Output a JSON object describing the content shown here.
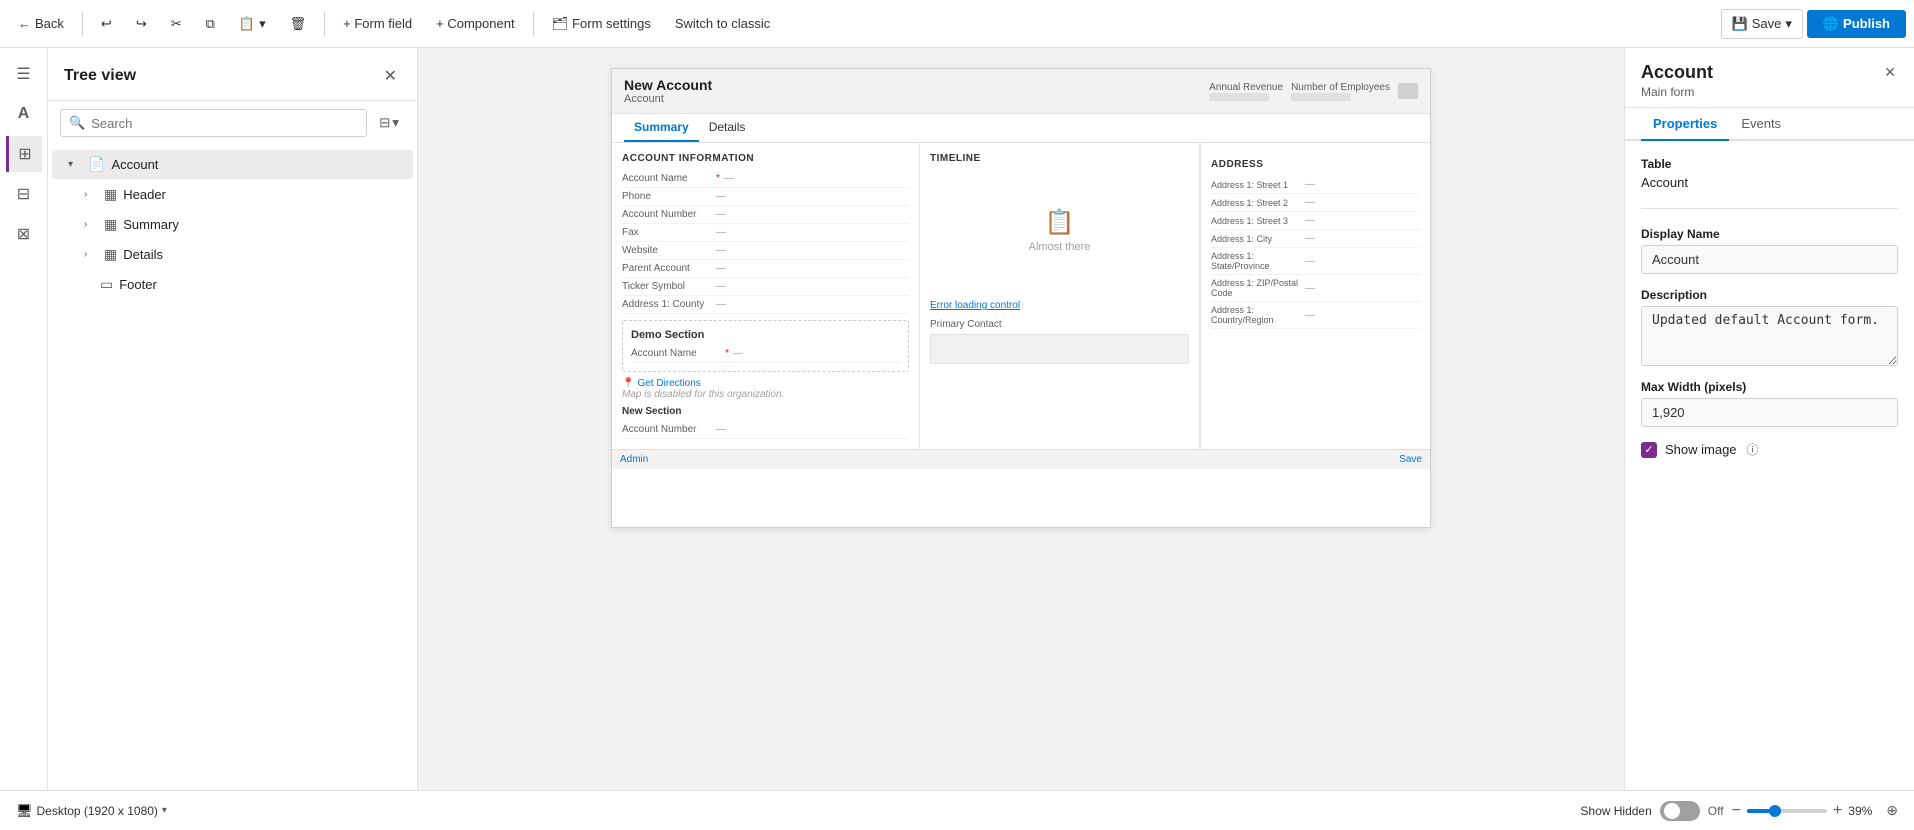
{
  "toolbar": {
    "back_label": "Back",
    "undo_icon": "↩",
    "redo_icon": "↪",
    "cut_icon": "✂",
    "copy_icon": "⧉",
    "paste_icon": "⬇",
    "undo_dropdown_icon": "▾",
    "delete_icon": "🗑",
    "form_field_label": "+ Form field",
    "component_label": "+ Component",
    "form_settings_label": "Form settings",
    "switch_classic_label": "Switch to classic",
    "save_label": "Save",
    "save_dropdown_icon": "▾",
    "publish_label": "Publish"
  },
  "sidebar": {
    "title": "Tree view",
    "close_icon": "✕",
    "search_placeholder": "Search",
    "filter_icon": "⊟",
    "filter_dropdown_icon": "▾",
    "tree": {
      "account": {
        "label": "Account",
        "chevron": "▾",
        "children": {
          "header": {
            "label": "Header",
            "chevron": "›"
          },
          "summary": {
            "label": "Summary",
            "chevron": "›"
          },
          "details": {
            "label": "Details",
            "chevron": "›"
          },
          "footer": {
            "label": "Footer"
          }
        }
      }
    }
  },
  "icon_bar": {
    "menu_icon": "☰",
    "text_icon": "A",
    "layers_icon": "⊞",
    "components_icon": "⊟",
    "grid_icon": "⊞"
  },
  "canvas": {
    "form_title": "New Account",
    "form_subtitle": "Account",
    "header_field1_label": "Annual Revenue",
    "header_field2_label": "Number of Employees",
    "tabs": {
      "summary_label": "Summary",
      "details_label": "Details",
      "active": "Summary"
    },
    "account_info_section": "ACCOUNT INFORMATION",
    "fields": [
      {
        "label": "Account Name",
        "value": "—",
        "required": true
      },
      {
        "label": "Phone",
        "value": "—"
      },
      {
        "label": "Account Number",
        "value": "—"
      },
      {
        "label": "Fax",
        "value": "—"
      },
      {
        "label": "Website",
        "value": "—"
      },
      {
        "label": "Parent Account",
        "value": "—"
      },
      {
        "label": "Ticker Symbol",
        "value": "—"
      },
      {
        "label": "Address 1: County",
        "value": "—"
      }
    ],
    "timeline_label": "Timeline",
    "timeline_almost_there": "Almost there",
    "error_loading_label": "Error loading control",
    "primary_contact_label": "Primary Contact",
    "address_section": "ADDRESS",
    "address_fields": [
      {
        "label": "Address 1: Street 1",
        "value": "—"
      },
      {
        "label": "Address 1: Street 2",
        "value": "—"
      },
      {
        "label": "Address 1: Street 3",
        "value": "—"
      },
      {
        "label": "Address 1: City",
        "value": "—"
      },
      {
        "label": "Address 1: State/Province",
        "value": "—"
      },
      {
        "label": "Address 1: ZIP/Postal Code",
        "value": "—"
      },
      {
        "label": "Address 1: Country/Region",
        "value": "—"
      }
    ],
    "demo_section_label": "Demo Section",
    "demo_account_name_label": "Account Name",
    "demo_account_name_value": "—",
    "demo_required": true,
    "get_directions_label": "Get Directions",
    "map_disabled_label": "Map is disabled for this organization.",
    "new_section_label": "New Section",
    "new_section_field_label": "Account Number",
    "new_section_field_value": "—",
    "bottom_left_label": "Admin",
    "bottom_right_label": "Save"
  },
  "bottom_bar": {
    "viewport_label": "Desktop (1920 x 1080)",
    "viewport_chevron": "▾",
    "show_hidden_label": "Show Hidden",
    "toggle_off_label": "Off",
    "zoom_minus_label": "−",
    "zoom_plus_label": "+",
    "zoom_pct_label": "39%",
    "zoom_fit_icon": "⊕"
  },
  "right_panel": {
    "title": "Account",
    "subtitle": "Main form",
    "close_icon": "✕",
    "tabs": {
      "properties_label": "Properties",
      "events_label": "Events",
      "active": "Properties"
    },
    "table_section_label": "Table",
    "table_value": "Account",
    "display_name_label": "Display Name",
    "display_name_value": "Account",
    "description_label": "Description",
    "description_value": "Updated default Account form.",
    "max_width_label": "Max Width (pixels)",
    "max_width_value": "1,920",
    "show_image_label": "Show image",
    "show_image_checked": true
  }
}
